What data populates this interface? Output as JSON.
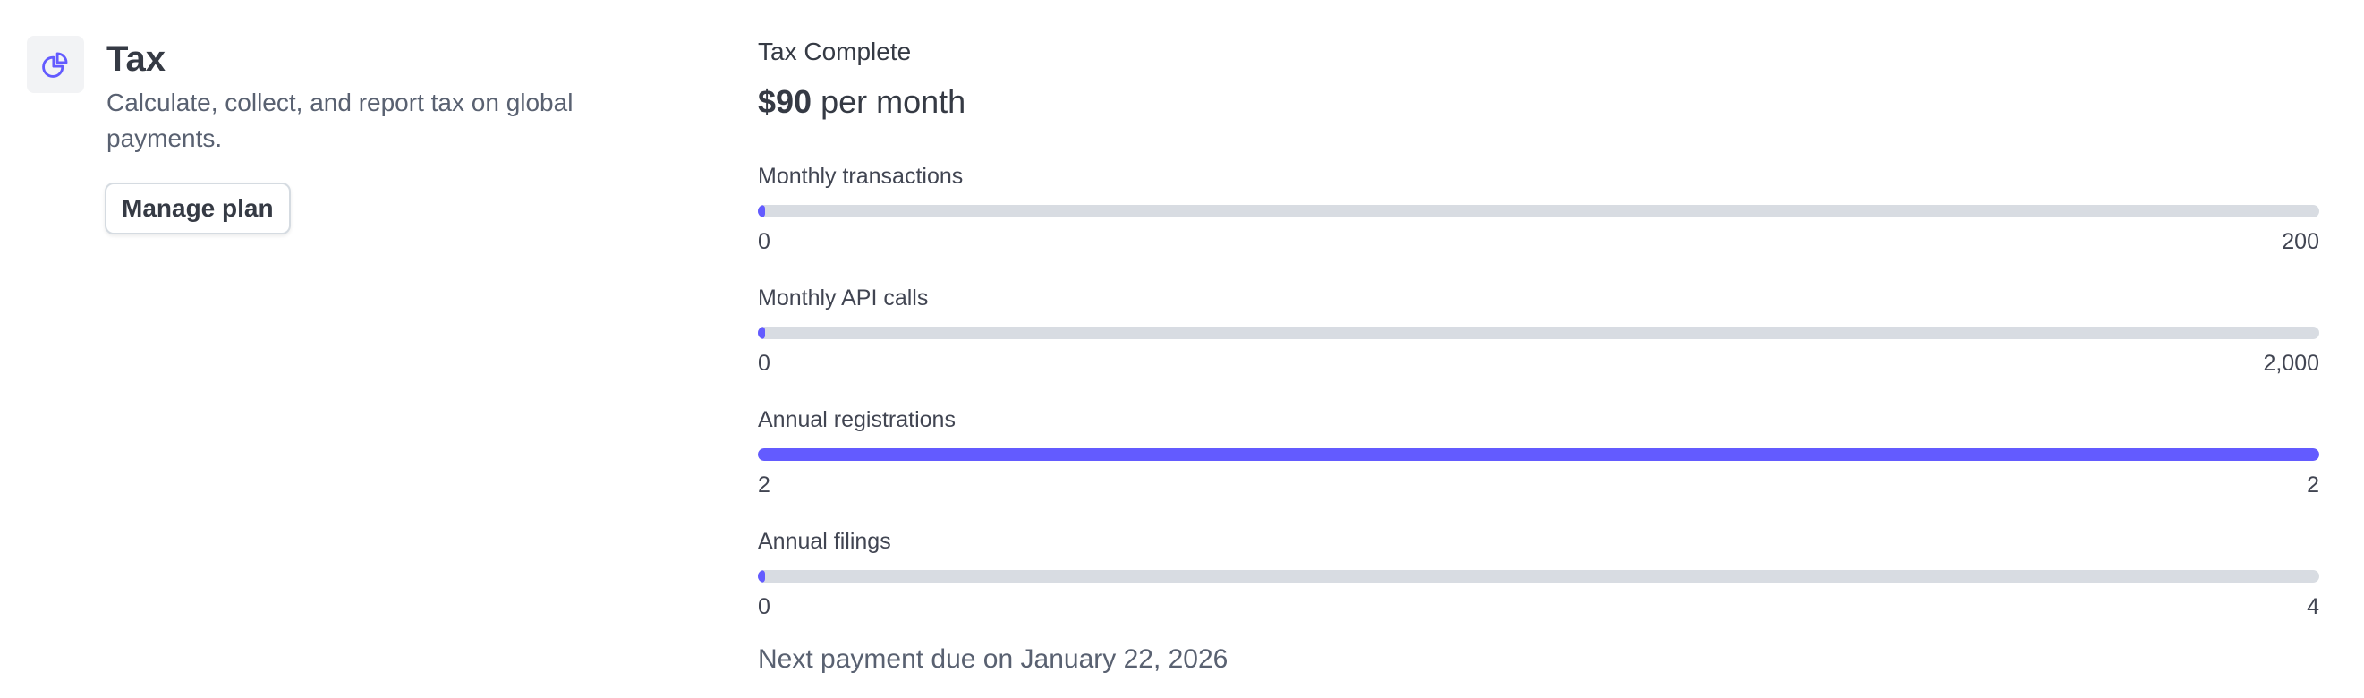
{
  "product": {
    "icon": "tax-pie-icon",
    "title": "Tax",
    "description": "Calculate, collect, and report tax on global payments.",
    "manage_button": "Manage plan"
  },
  "plan": {
    "name": "Tax Complete",
    "price_amount": "$90",
    "price_period": "per month"
  },
  "meters": [
    {
      "label": "Monthly transactions",
      "min": "0",
      "max": "200",
      "used_fraction": 0.0
    },
    {
      "label": "Monthly API calls",
      "min": "0",
      "max": "2,000",
      "used_fraction": 0.0
    },
    {
      "label": "Annual registrations",
      "min": "2",
      "max": "2",
      "used_fraction": 1.0
    },
    {
      "label": "Annual filings",
      "min": "0",
      "max": "4",
      "used_fraction": 0.0
    }
  ],
  "next_payment": "Next payment due on January 22, 2026",
  "colors": {
    "accent": "#635bff",
    "track": "#d8dce2"
  }
}
